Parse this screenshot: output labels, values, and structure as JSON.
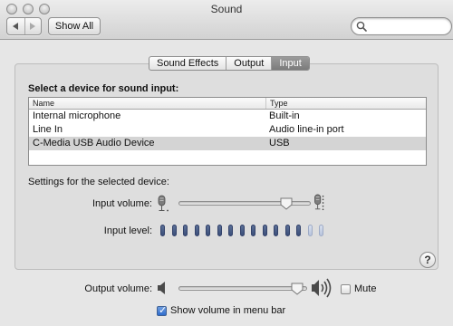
{
  "window": {
    "title": "Sound"
  },
  "toolbar": {
    "show_all_label": "Show All"
  },
  "search": {
    "placeholder": "",
    "value": ""
  },
  "tabs": [
    {
      "label": "Sound Effects",
      "active": false
    },
    {
      "label": "Output",
      "active": false
    },
    {
      "label": "Input",
      "active": true
    }
  ],
  "input_pane": {
    "device_heading": "Select a device for sound input:",
    "table": {
      "columns": [
        "Name",
        "Type"
      ],
      "rows": [
        {
          "name": "Internal microphone",
          "type": "Built-in",
          "selected": false
        },
        {
          "name": "Line In",
          "type": "Audio line-in port",
          "selected": false
        },
        {
          "name": "C-Media USB Audio Device",
          "type": "USB",
          "selected": true
        }
      ]
    },
    "settings_label": "Settings for the selected device:",
    "input_volume_label": "Input volume:",
    "input_volume_fraction": 0.85,
    "input_level_label": "Input level:",
    "input_level": {
      "segments_total": 15,
      "segments_lit": 13
    }
  },
  "output": {
    "volume_label": "Output volume:",
    "volume_fraction": 0.97,
    "mute_label": "Mute",
    "mute_checked": false,
    "show_volume_label": "Show volume in menu bar",
    "show_volume_checked": true
  },
  "icons": {
    "window_buttons": [
      "close-icon",
      "minimize-icon",
      "zoom-icon"
    ],
    "nav": [
      "back-arrow-icon",
      "forward-arrow-icon"
    ],
    "search": "magnifying-glass-icon",
    "input_volume_low": "microphone-low-icon",
    "input_volume_high": "microphone-high-icon",
    "output_volume_low": "speaker-low-icon",
    "output_volume_high": "speaker-high-icon",
    "help": "?"
  },
  "colors": {
    "level_on": "#3b4e79",
    "level_off": "#b8c4dc",
    "checkbox_checked": "#2e6ccd"
  }
}
